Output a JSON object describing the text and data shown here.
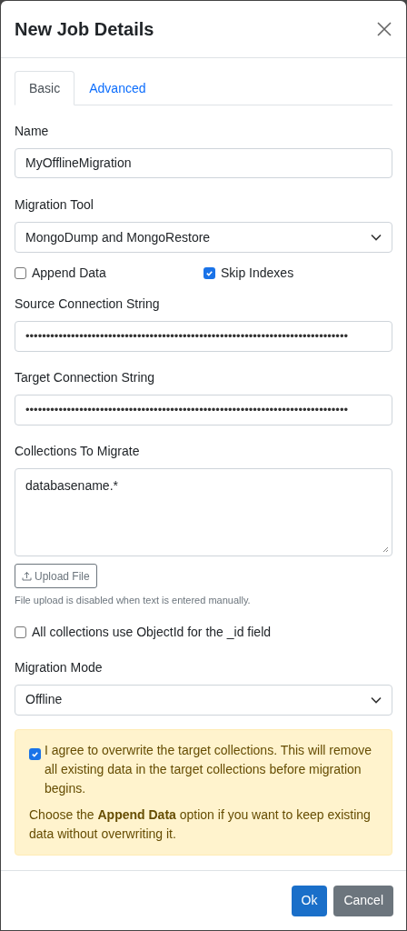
{
  "dialog": {
    "title": "New Job Details"
  },
  "tabs": [
    {
      "label": "Basic",
      "selected": true
    },
    {
      "label": "Advanced",
      "selected": false
    }
  ],
  "name": {
    "label": "Name",
    "value": "MyOfflineMigration"
  },
  "migration_tool": {
    "label": "Migration Tool",
    "value": "MongoDump and MongoRestore"
  },
  "options": [
    {
      "label": "Append Data",
      "checked": false
    },
    {
      "label": "Skip Indexes",
      "checked": true
    }
  ],
  "source": {
    "label": "Source Connection String",
    "value": "••••••••••••••••••••••••••••••••••••••••••••••••••••••••••••••••••••••••••••••"
  },
  "target": {
    "label": "Target Connection String",
    "value": "••••••••••••••••••••••••••••••••••••••••••••••••••••••••••••••••••••••••••••••"
  },
  "collections": {
    "label": "Collections To Migrate",
    "value": "databasename.*"
  },
  "upload": {
    "label": "Upload File",
    "help": "File upload is disabled when text is entered manually."
  },
  "objectid": {
    "label": "All collections use ObjectId for the _id field",
    "checked": false
  },
  "migration_mode": {
    "label": "Migration Mode",
    "value": "Offline"
  },
  "warning": {
    "agree_label": "I agree to overwrite the target collections. This will remove all existing data in the target collections before migration begins.",
    "agree_checked": true,
    "note": "Choose the **Append Data** option if you want to keep existing data without overwriting it."
  },
  "buttons": [
    {
      "label": "Ok",
      "kind": "primary"
    },
    {
      "label": "Cancel",
      "kind": "secondary"
    }
  ]
}
